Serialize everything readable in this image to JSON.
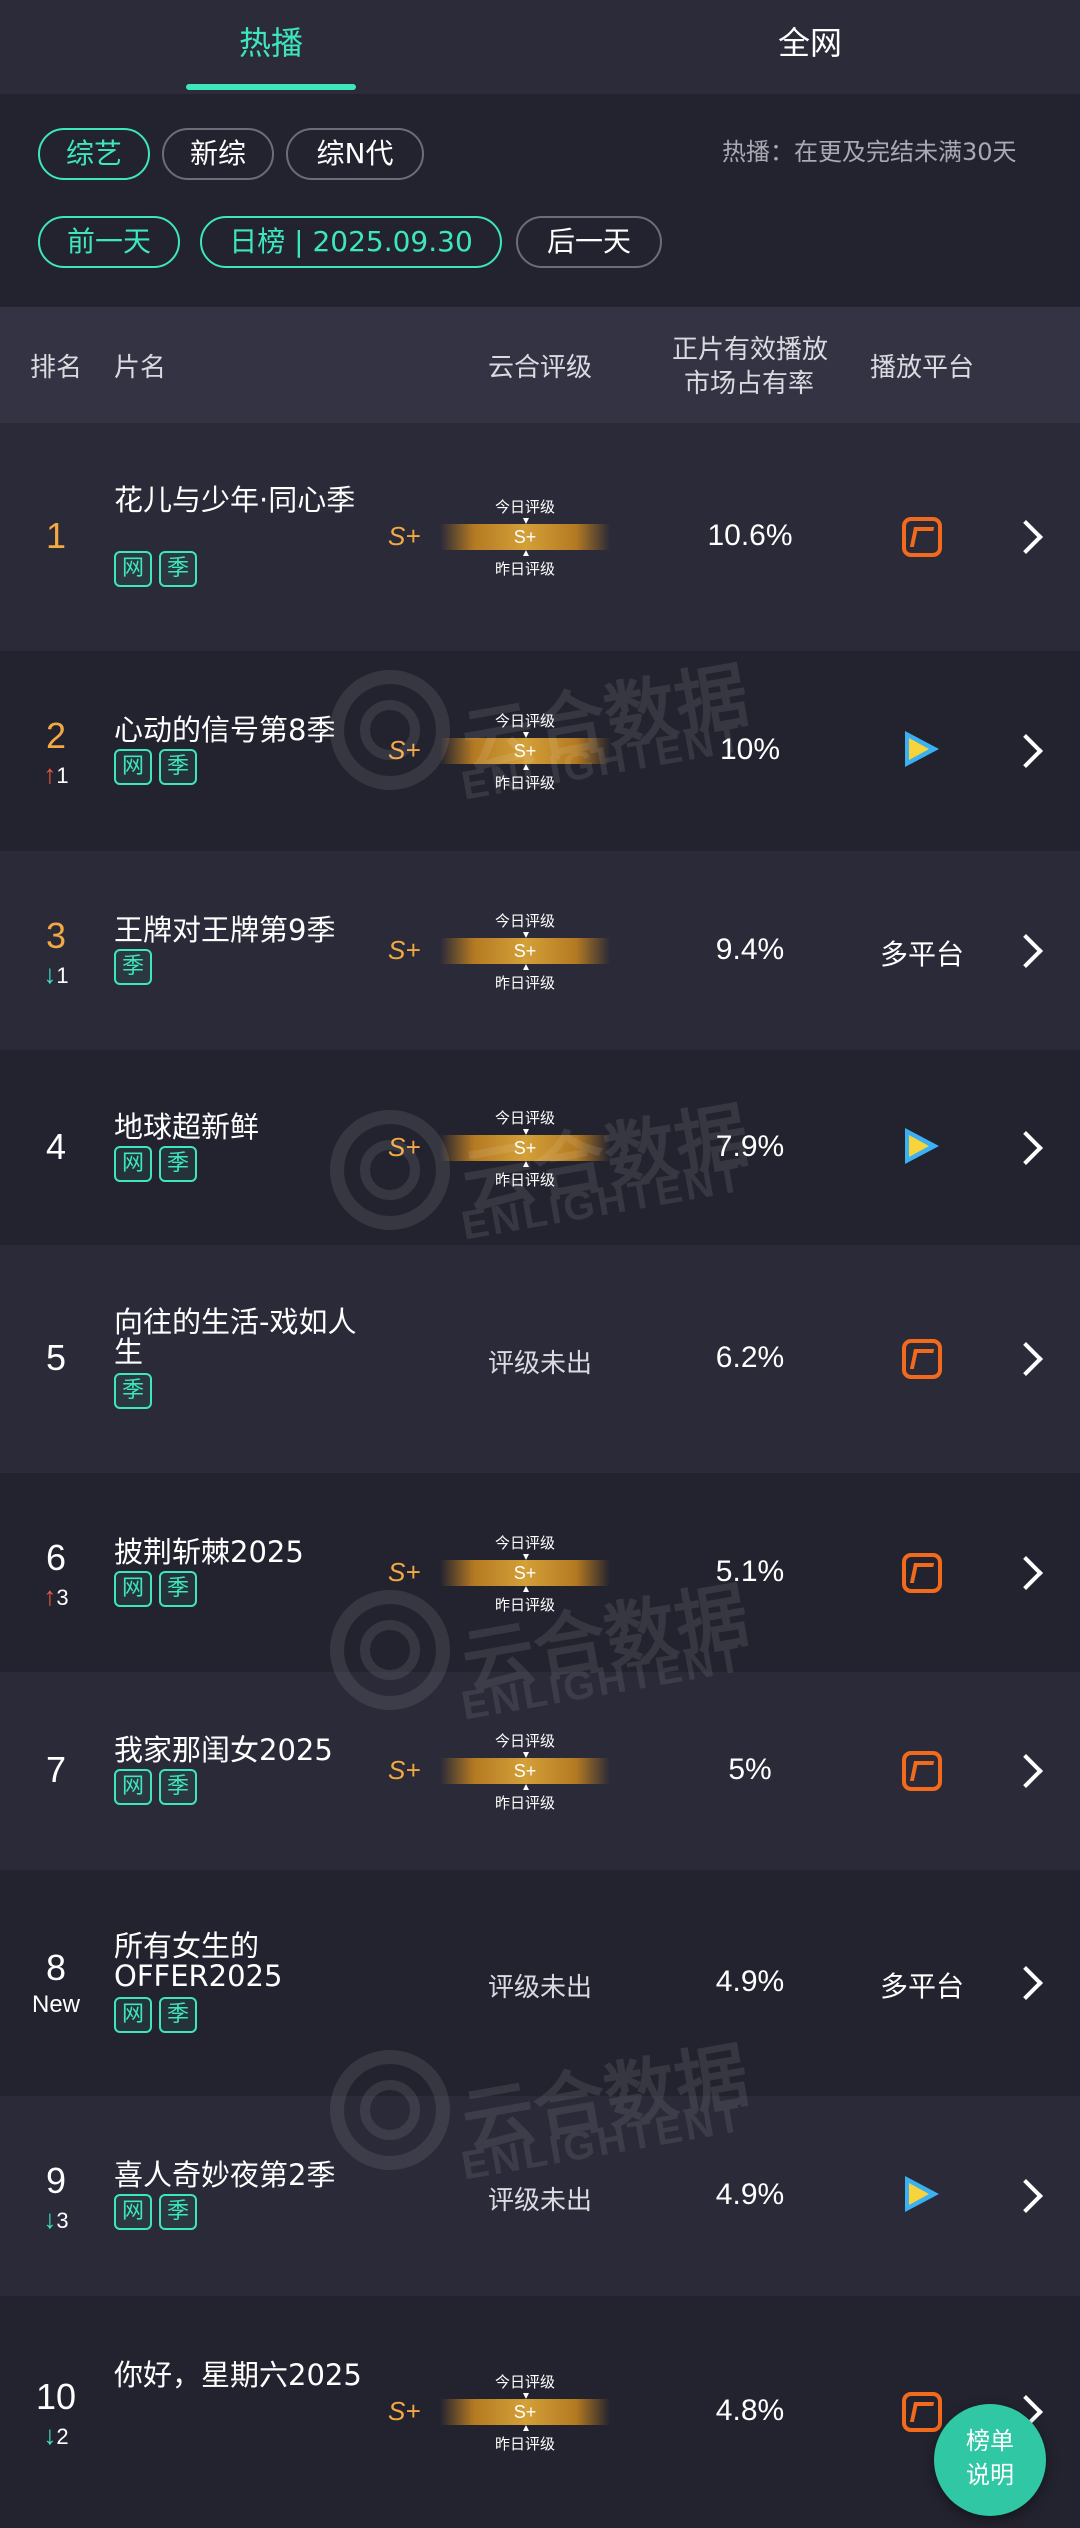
{
  "top_tabs": [
    {
      "label": "热播",
      "active": true
    },
    {
      "label": "全网",
      "active": false
    }
  ],
  "category_filters": [
    {
      "label": "综艺",
      "active": true
    },
    {
      "label": "新综",
      "active": false
    },
    {
      "label": "综N代",
      "active": false
    }
  ],
  "hint": "热播：在更及完结未满30天",
  "date_nav": {
    "prev": "前一天",
    "current": "日榜 | 2025.09.30",
    "next": "后一天"
  },
  "table_header": {
    "rank": "排名",
    "name": "片名",
    "rating": "云合评级",
    "share_line1": "正片有效播放",
    "share_line2": "市场占有率",
    "platform": "播放平台"
  },
  "rating_labels": {
    "today": "今日评级",
    "yesterday": "昨日评级",
    "none": "评级未出"
  },
  "rows": [
    {
      "rank": "1",
      "change": "",
      "change_dir": "none",
      "title": "花儿与少年·同心季",
      "tags": [
        "网",
        "季"
      ],
      "grade": "S+",
      "bar_grade": "S+",
      "rated": true,
      "share": "10.6%",
      "platform": "mango-tv-icon",
      "platform_text": ""
    },
    {
      "rank": "2",
      "change": "1",
      "change_dir": "up",
      "title": "心动的信号第8季",
      "tags": [
        "网",
        "季"
      ],
      "grade": "S+",
      "bar_grade": "S+",
      "rated": true,
      "share": "10%",
      "platform": "tencent-video-icon",
      "platform_text": ""
    },
    {
      "rank": "3",
      "change": "1",
      "change_dir": "down",
      "title": "王牌对王牌第9季",
      "tags": [
        "季"
      ],
      "grade": "S+",
      "bar_grade": "S+",
      "rated": true,
      "share": "9.4%",
      "platform": "text",
      "platform_text": "多平台"
    },
    {
      "rank": "4",
      "change": "",
      "change_dir": "none",
      "title": "地球超新鲜",
      "tags": [
        "网",
        "季"
      ],
      "grade": "S+",
      "bar_grade": "S+",
      "rated": true,
      "share": "7.9%",
      "platform": "tencent-video-icon",
      "platform_text": ""
    },
    {
      "rank": "5",
      "change": "",
      "change_dir": "none",
      "title": "向往的生活-戏如人生",
      "tags": [
        "季"
      ],
      "grade": "",
      "bar_grade": "",
      "rated": false,
      "share": "6.2%",
      "platform": "mango-tv-icon",
      "platform_text": ""
    },
    {
      "rank": "6",
      "change": "3",
      "change_dir": "up",
      "title": "披荆斩棘2025",
      "tags": [
        "网",
        "季"
      ],
      "grade": "S+",
      "bar_grade": "S+",
      "rated": true,
      "share": "5.1%",
      "platform": "mango-tv-icon",
      "platform_text": ""
    },
    {
      "rank": "7",
      "change": "",
      "change_dir": "none",
      "title": "我家那闺女2025",
      "tags": [
        "网",
        "季"
      ],
      "grade": "S+",
      "bar_grade": "S+",
      "rated": true,
      "share": "5%",
      "platform": "mango-tv-icon",
      "platform_text": ""
    },
    {
      "rank": "8",
      "change": "New",
      "change_dir": "new",
      "title": "所有女生的OFFER2025",
      "tags": [
        "网",
        "季"
      ],
      "grade": "",
      "bar_grade": "",
      "rated": false,
      "share": "4.9%",
      "platform": "text",
      "platform_text": "多平台"
    },
    {
      "rank": "9",
      "change": "3",
      "change_dir": "down",
      "title": "喜人奇妙夜第2季",
      "tags": [
        "网",
        "季"
      ],
      "grade": "",
      "bar_grade": "",
      "rated": false,
      "share": "4.9%",
      "platform": "tencent-video-icon",
      "platform_text": ""
    },
    {
      "rank": "10",
      "change": "2",
      "change_dir": "down",
      "title": "你好，星期六2025",
      "tags": [],
      "grade": "S+",
      "bar_grade": "S+",
      "rated": true,
      "share": "4.8%",
      "platform": "mango-tv-icon",
      "platform_text": ""
    }
  ],
  "watermark": {
    "brand_cn": "云合数据",
    "brand_en": "ENLIGHTENT"
  },
  "fab": {
    "line1": "榜单",
    "line2": "说明"
  },
  "colors": {
    "accent": "#3ee6be",
    "gold": "#f2a843",
    "up": "#ef5a3a",
    "down": "#3ee6be",
    "mango": "#f26a1b",
    "bg": "#23232f"
  }
}
